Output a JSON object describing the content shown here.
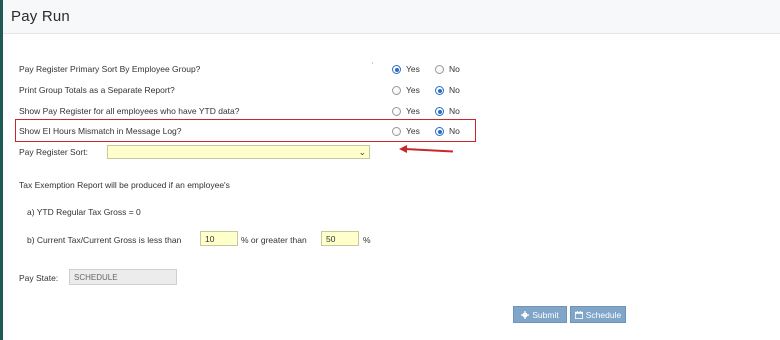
{
  "header": {
    "title": "Pay Run"
  },
  "settings": [
    {
      "label": "Pay Register Primary Sort By Employee Group?",
      "yes_label": "Yes",
      "no_label": "No",
      "selected": "yes"
    },
    {
      "label": "Print Group Totals as a Separate Report?",
      "yes_label": "Yes",
      "no_label": "No",
      "selected": "no"
    },
    {
      "label": "Show Pay Register for all employees who have YTD data?",
      "yes_label": "Yes",
      "no_label": "No",
      "selected": "no"
    },
    {
      "label": "Show EI Hours Mismatch in Message Log?",
      "yes_label": "Yes",
      "no_label": "No",
      "selected": "no"
    }
  ],
  "sort": {
    "label": "Pay Register Sort:",
    "value": ""
  },
  "tax_exemption": {
    "intro": "Tax Exemption Report will be produced if an employee's",
    "line_a": "a) YTD Regular Tax Gross = 0",
    "line_b_prefix": "b) Current Tax/Current Gross is less than",
    "lower_value": "10",
    "middle_text": "% or greater than",
    "upper_value": "50",
    "suffix": "%"
  },
  "pay_state": {
    "label": "Pay State:",
    "value": "SCHEDULE"
  },
  "buttons": {
    "submit": "Submit",
    "schedule": "Schedule"
  },
  "colors": {
    "highlight": "#c9272b",
    "field_bg": "#ffffcc",
    "button": "#7fa5c9",
    "radio_checked": "#2a6cc8",
    "accent": "#1f5a55"
  },
  "icons": {
    "submit": "gear-icon",
    "schedule": "calendar-icon",
    "annotation": "red-arrow-icon"
  }
}
